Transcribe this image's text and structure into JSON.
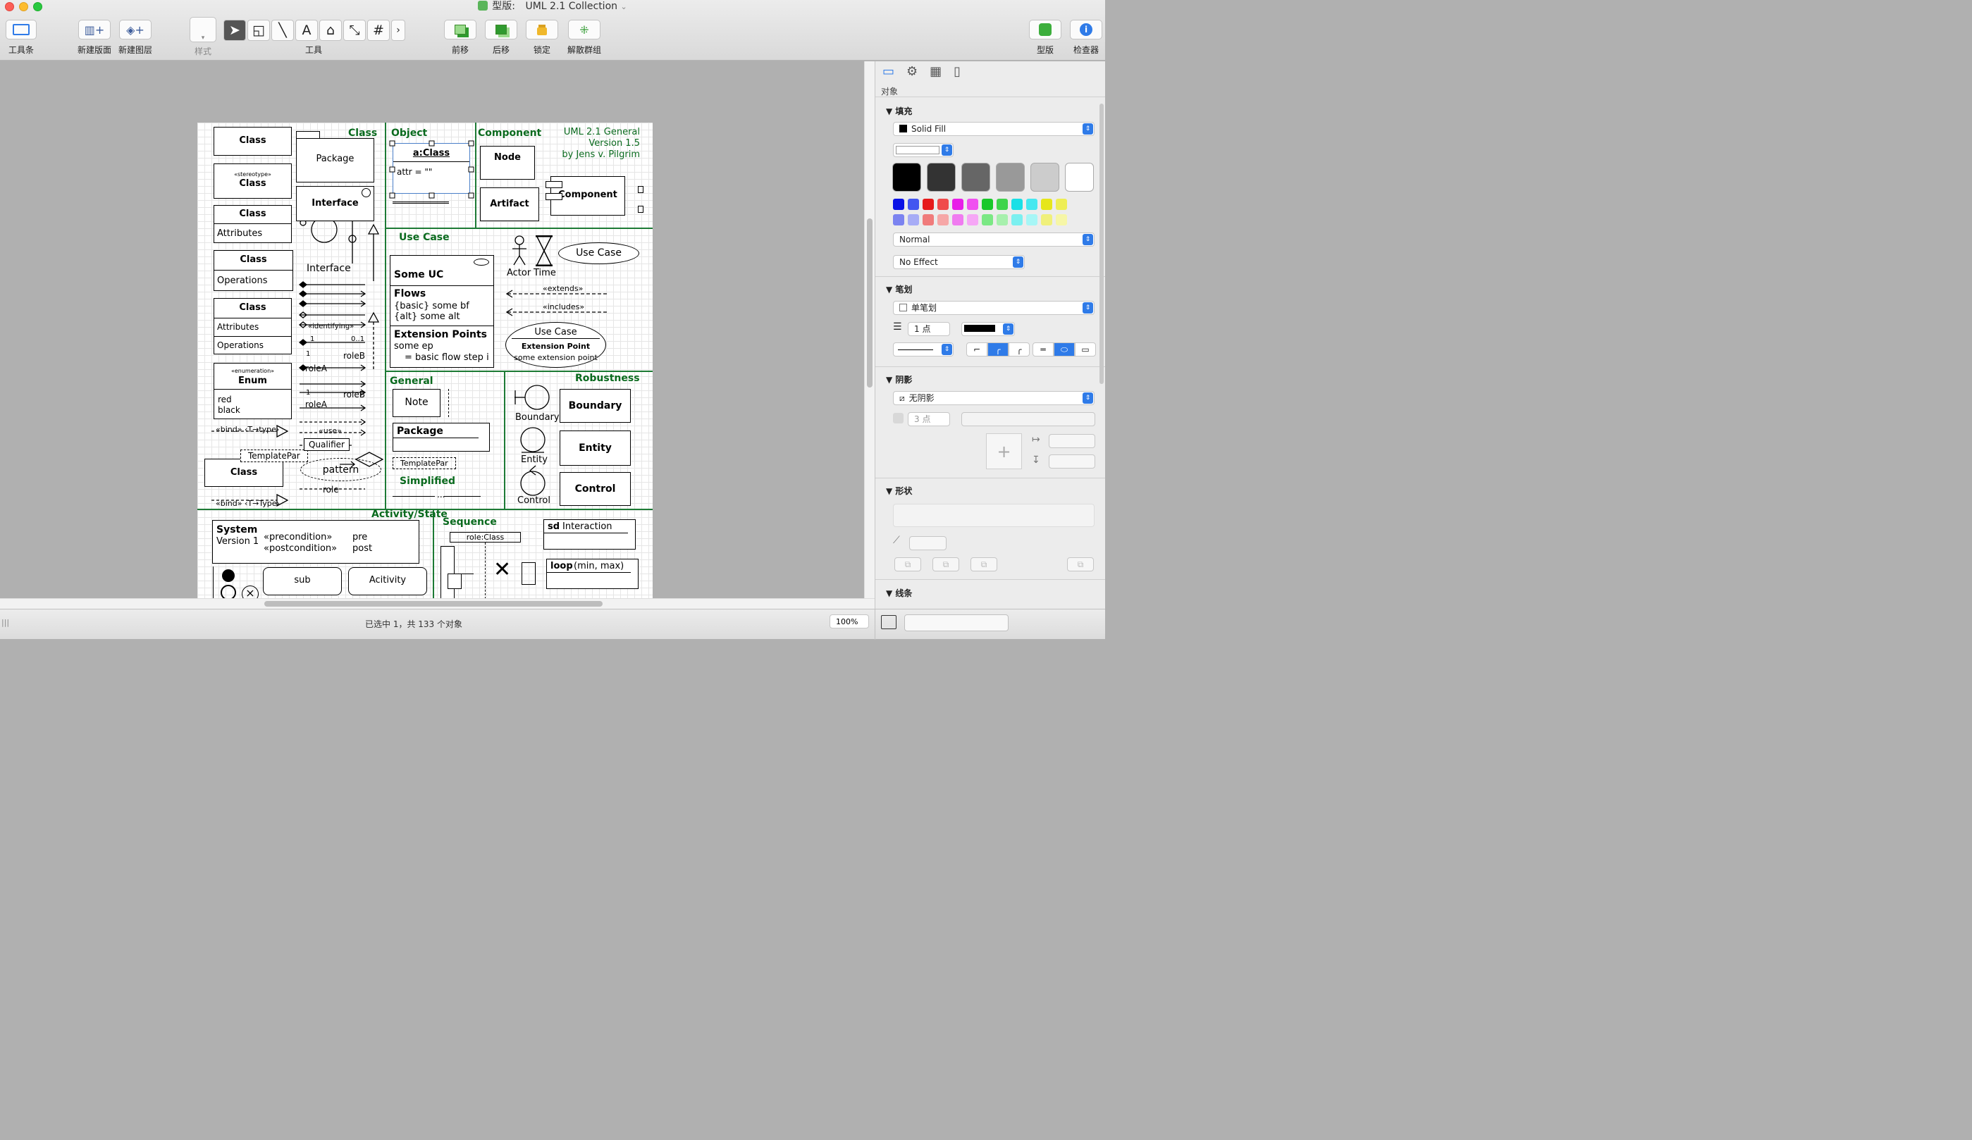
{
  "window": {
    "title_prefix": "型版:",
    "title": "UML 2.1 Collection",
    "title_arrow": "⌄"
  },
  "toolbar": {
    "toolbar_label": "工具条",
    "new_canvas": "新建版面",
    "new_layer": "新建图层",
    "style": "样式",
    "tools": "工具",
    "bring_front": "前移",
    "send_back": "后移",
    "lock": "锁定",
    "ungroup": "解散群组",
    "stencils": "型版",
    "inspector": "检查器",
    "tool_glyphs": [
      "➤",
      "◱",
      "╲",
      "A",
      "⌂",
      "⤡",
      "#",
      "›"
    ]
  },
  "sheet": {
    "h_class": "Class",
    "h_object": "Object",
    "h_component": "Component",
    "uml_title": [
      "UML 2.1 General",
      "Version 1.5",
      "by Jens v. Pilgrim"
    ],
    "class": "Class",
    "stereotype": "«stereotype»",
    "package": "Package",
    "interface": "Interface",
    "attributes": "Attributes",
    "operations": "Operations",
    "enumeration": "«enumeration»",
    "enum": "Enum",
    "red": "red",
    "black": "black",
    "identifying": "«identifying»",
    "one": "1",
    "zero_one": "0..1",
    "roleB": "roleB",
    "roleA": "roleA",
    "star": "*",
    "bind1": "«bind» ‹T→type›",
    "bind2": "«bind» ‹T→Type›",
    "use": "«use»",
    "qualifier": "Qualifier",
    "templatepar": "TemplatePar",
    "pattern": "pattern",
    "role": "role",
    "aclass": "a:Class",
    "attr": "attr = \"\"",
    "node": "Node",
    "artifact": "Artifact",
    "component": "Component",
    "h_usecase": "Use Case",
    "some_uc": "Some UC",
    "flows": "Flows",
    "flows_basic": "{basic} some bf",
    "flows_alt": "{alt} some alt",
    "ext_points": "Extension Points",
    "some_ep": "some ep",
    "basic_flow": "= basic flow step i",
    "actor": "Actor",
    "time": "Time",
    "use_case": "Use Case",
    "extends": "«extends»",
    "includes": "«includes»",
    "use_case2": "Use Case",
    "extension_point": "Extension Point",
    "some_extension_point": "some extension point",
    "h_general": "General",
    "note": "Note",
    "package2": "Package",
    "templatepar2": "TemplatePar",
    "h_simplified": "Simplified",
    "dots": "...",
    "h_robustness": "Robustness",
    "boundary": "Boundary",
    "entity": "Entity",
    "control": "Control",
    "h_activity": "Activity/State",
    "system": "System",
    "version": "Version 1",
    "precondition": "«precondition»",
    "postcondition": "«postcondition»",
    "pre": "pre",
    "post": "post",
    "sub": "sub",
    "acitivity": "Acitivity",
    "h_sequence": "Sequence",
    "roleclass": "role:Class",
    "sd": "sd",
    "interaction": "Interaction",
    "loop": "loop",
    "loop_args": "(min, max)"
  },
  "inspector": {
    "tab_label": "对象",
    "fill": {
      "title": "填充",
      "type": "Solid Fill",
      "blend": "Normal",
      "effect": "No Effect",
      "swatches": [
        "#000000",
        "#333333",
        "#666666",
        "#999999",
        "#cccccc",
        "#ffffff"
      ],
      "palette_row1": [
        "#0a12e6",
        "#4356f0",
        "#e61a1a",
        "#f04b4b",
        "#e81ee8",
        "#f050f0",
        "#19c82a",
        "#3fd44c",
        "#19e0e6",
        "#45e8f0",
        "#e6e61a",
        "#eeee55"
      ],
      "palette_row2": [
        "#7b83f0",
        "#a7acf6",
        "#f07b7b",
        "#f6a7a7",
        "#f07bf0",
        "#f6a7f6",
        "#7be884",
        "#a7f0ad",
        "#7bf0f0",
        "#a7f6f6",
        "#f0f07b",
        "#f6f6a7"
      ]
    },
    "stroke": {
      "title": "笔划",
      "type": "单笔划",
      "width": "1 点"
    },
    "shadow": {
      "title": "阴影",
      "type": "无阴影",
      "size": "3 点"
    },
    "shape": {
      "title": "形状"
    },
    "lines": {
      "title": "线条"
    }
  },
  "status": {
    "selection": "已选中 1，共 133 个对象",
    "zoom": "100%"
  }
}
